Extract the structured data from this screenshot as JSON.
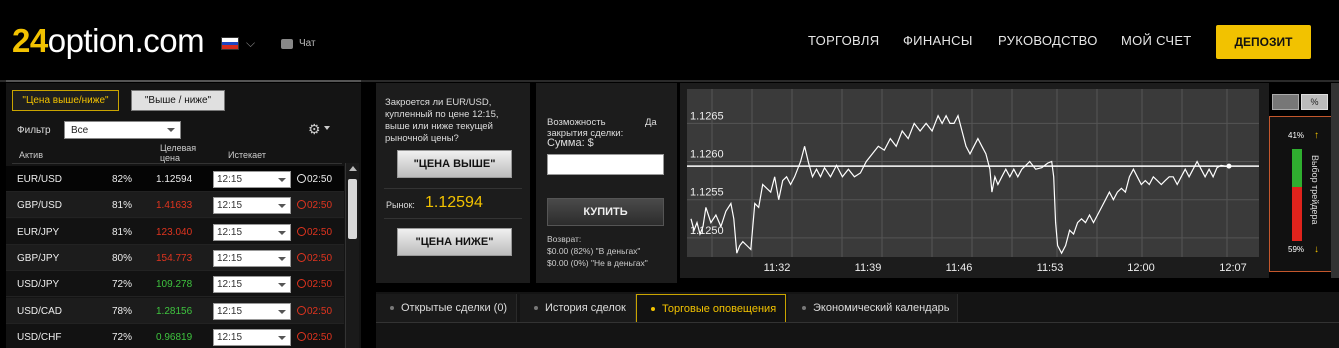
{
  "header": {
    "logo_num": "24",
    "logo_text": "option.com",
    "chat_label": "Чат",
    "nav": [
      "ТОРГОВЛЯ",
      "ФИНАНСЫ",
      "РУКОВОДСТВО",
      "МОЙ СЧЕТ"
    ],
    "deposit_label": "ДЕПОЗИТ"
  },
  "left_panel": {
    "tab_active": "\"Цена выше/ниже\"",
    "tab_other": "\"Выше / ниже\"",
    "filter_label": "Фильтр",
    "filter_value": "Все",
    "columns": {
      "asset": "Актив",
      "target_price": "Целевая цена",
      "expires": "Истекает"
    },
    "rows": [
      {
        "asset": "EUR/USD",
        "pct": "82%",
        "price": "1.12594",
        "price_color": "white",
        "expiry": "12:15",
        "timer": "02:50",
        "timer_color": "w"
      },
      {
        "asset": "GBP/USD",
        "pct": "81%",
        "price": "1.41633",
        "price_color": "red",
        "expiry": "12:15",
        "timer": "02:50",
        "timer_color": "r"
      },
      {
        "asset": "EUR/JPY",
        "pct": "81%",
        "price": "123.040",
        "price_color": "red",
        "expiry": "12:15",
        "timer": "02:50",
        "timer_color": "r"
      },
      {
        "asset": "GBP/JPY",
        "pct": "80%",
        "price": "154.773",
        "price_color": "red",
        "expiry": "12:15",
        "timer": "02:50",
        "timer_color": "r"
      },
      {
        "asset": "USD/JPY",
        "pct": "72%",
        "price": "109.278",
        "price_color": "green",
        "expiry": "12:15",
        "timer": "02:50",
        "timer_color": "r"
      },
      {
        "asset": "USD/CAD",
        "pct": "78%",
        "price": "1.28156",
        "price_color": "green",
        "expiry": "12:15",
        "timer": "02:50",
        "timer_color": "r"
      },
      {
        "asset": "USD/CHF",
        "pct": "72%",
        "price": "0.96819",
        "price_color": "green",
        "expiry": "12:15",
        "timer": "02:50",
        "timer_color": "r"
      }
    ]
  },
  "trade": {
    "question": "Закроется ли EUR/USD, купленный по цене 12:15, выше или ниже текущей рыночной цены?",
    "higher_label": "\"ЦЕНА ВЫШЕ\"",
    "market_label": "Рынок:",
    "market_value": "1.12594",
    "lower_label": "\"ЦЕНА НИЖЕ\"",
    "close_option_label": "Возможность закрытия сделки:",
    "close_option_value": "Да",
    "amount_label": "Сумма:  $",
    "buy_label": "КУПИТЬ",
    "return_label": "Возврат:",
    "return_in_money": "$0.00 (82%) \"В деньгах\"",
    "return_out_money": "$0.00 (0%) \"Не в деньгах\""
  },
  "sentiment": {
    "title": "Выбор трейдера",
    "up_pct": "41%",
    "down_pct": "59%",
    "up_fraction": 0.41,
    "toggle_pct": "%"
  },
  "chart_data": {
    "type": "line",
    "x_ticks": [
      "11:32",
      "11:39",
      "11:46",
      "11:53",
      "12:00",
      "12:07"
    ],
    "y_ticks": [
      "1.1265",
      "1.1260",
      "1.1255",
      "1.1250"
    ],
    "ylim": [
      1.12475,
      1.12695
    ],
    "reference_line": 1.12594,
    "series": [
      {
        "values": [
          [
            0,
            1.12525
          ],
          [
            3,
            1.1251
          ],
          [
            6,
            1.1252
          ],
          [
            9,
            1.12505
          ],
          [
            12,
            1.12515
          ],
          [
            15,
            1.1254
          ],
          [
            20,
            1.1252
          ],
          [
            25,
            1.1253
          ],
          [
            30,
            1.12515
          ],
          [
            35,
            1.12535
          ],
          [
            40,
            1.12545
          ],
          [
            43,
            1.12525
          ],
          [
            46,
            1.1248
          ],
          [
            49,
            1.1249
          ],
          [
            52,
            1.12495
          ],
          [
            56,
            1.1249
          ],
          [
            60,
            1.12485
          ],
          [
            64,
            1.12545
          ],
          [
            68,
            1.1254
          ],
          [
            72,
            1.1257
          ],
          [
            76,
            1.12565
          ],
          [
            80,
            1.1256
          ],
          [
            84,
            1.1258
          ],
          [
            88,
            1.1255
          ],
          [
            92,
            1.12575
          ],
          [
            96,
            1.1258
          ],
          [
            100,
            1.1257
          ],
          [
            104,
            1.1258
          ],
          [
            110,
            1.126
          ],
          [
            114,
            1.1262
          ],
          [
            118,
            1.12598
          ],
          [
            122,
            1.1258
          ],
          [
            126,
            1.1259
          ],
          [
            130,
            1.1258
          ],
          [
            134,
            1.12592
          ],
          [
            140,
            1.1258
          ],
          [
            146,
            1.12595
          ],
          [
            152,
            1.1258
          ],
          [
            158,
            1.1259
          ],
          [
            164,
            1.1258
          ],
          [
            170,
            1.12585
          ],
          [
            176,
            1.126
          ],
          [
            182,
            1.1261
          ],
          [
            188,
            1.1262
          ],
          [
            194,
            1.12615
          ],
          [
            200,
            1.1263
          ],
          [
            206,
            1.1262
          ],
          [
            212,
            1.1264
          ],
          [
            218,
            1.1263
          ],
          [
            224,
            1.1265
          ],
          [
            230,
            1.1264
          ],
          [
            236,
            1.1265
          ],
          [
            242,
            1.1264
          ],
          [
            248,
            1.1266
          ],
          [
            252,
            1.1265
          ],
          [
            256,
            1.1266
          ],
          [
            260,
            1.1265
          ],
          [
            264,
            1.1265
          ],
          [
            268,
            1.1266
          ],
          [
            272,
            1.1264
          ],
          [
            276,
            1.1262
          ],
          [
            280,
            1.1261
          ],
          [
            284,
            1.1262
          ],
          [
            288,
            1.1263
          ],
          [
            292,
            1.1262
          ],
          [
            296,
            1.1261
          ],
          [
            300,
            1.1259
          ],
          [
            302,
            1.1256
          ],
          [
            305,
            1.1258
          ],
          [
            308,
            1.1257
          ],
          [
            312,
            1.1258
          ],
          [
            316,
            1.1259
          ],
          [
            320,
            1.1258
          ],
          [
            324,
            1.1259
          ],
          [
            328,
            1.1258
          ],
          [
            332,
            1.1259
          ],
          [
            336,
            1.12595
          ],
          [
            340,
            1.126
          ],
          [
            346,
            1.1259
          ],
          [
            352,
            1.12592
          ],
          [
            358,
            1.12598
          ],
          [
            362,
            1.126
          ],
          [
            364,
            1.1258
          ],
          [
            366,
            1.1252
          ],
          [
            368,
            1.1249
          ],
          [
            372,
            1.1248
          ],
          [
            376,
            1.1249
          ],
          [
            380,
            1.1251
          ],
          [
            384,
            1.12505
          ],
          [
            388,
            1.1252
          ],
          [
            392,
            1.12525
          ],
          [
            396,
            1.1252
          ],
          [
            400,
            1.1253
          ],
          [
            404,
            1.1252
          ],
          [
            408,
            1.1253
          ],
          [
            412,
            1.1254
          ],
          [
            416,
            1.1255
          ],
          [
            420,
            1.1256
          ],
          [
            424,
            1.1255
          ],
          [
            428,
            1.1256
          ],
          [
            432,
            1.12565
          ],
          [
            436,
            1.1256
          ],
          [
            440,
            1.1258
          ],
          [
            444,
            1.1259
          ],
          [
            448,
            1.1258
          ],
          [
            452,
            1.1257
          ],
          [
            456,
            1.12575
          ],
          [
            460,
            1.1257
          ],
          [
            464,
            1.1258
          ],
          [
            468,
            1.12575
          ],
          [
            472,
            1.1257
          ],
          [
            476,
            1.12575
          ],
          [
            480,
            1.1258
          ],
          [
            484,
            1.1258
          ],
          [
            488,
            1.1257
          ],
          [
            492,
            1.1258
          ],
          [
            496,
            1.1259
          ],
          [
            500,
            1.1258
          ],
          [
            504,
            1.1259
          ],
          [
            508,
            1.126
          ],
          [
            512,
            1.1259
          ],
          [
            516,
            1.1258
          ],
          [
            520,
            1.1259
          ],
          [
            524,
            1.1258
          ],
          [
            528,
            1.12592
          ],
          [
            532,
            1.12595
          ],
          [
            536,
            1.12594
          ],
          [
            540,
            1.12594
          ]
        ]
      }
    ]
  },
  "bottom_tabs": [
    "Открытые сделки (0)",
    "История сделок",
    "Торговые оповещения",
    "Экономический календарь"
  ]
}
